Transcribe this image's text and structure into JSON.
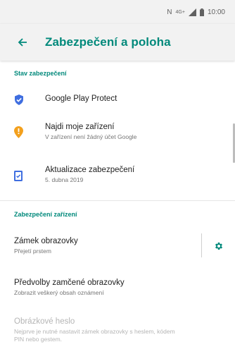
{
  "status_bar": {
    "nfc": "N",
    "network": "4G+",
    "time": "10:00"
  },
  "app_bar": {
    "title": "Zabezpečení a poloha"
  },
  "security_status": {
    "header": "Stav zabezpečení",
    "items": [
      {
        "label": "Google Play Protect",
        "summary": "",
        "icon": "shield-icon",
        "icon_color": "#3f6ee0"
      },
      {
        "label": "Najdi moje zařízení",
        "summary": "V zařízení není žádný účet Google",
        "icon": "location-icon",
        "icon_color": "#f3a01d"
      },
      {
        "label": "Aktualizace zabezpečení",
        "summary": "5. dubna 2019",
        "icon": "update-icon",
        "icon_color": "#3f6ee0"
      }
    ]
  },
  "device_security": {
    "header": "Zabezpečení zařízení",
    "screen_lock": {
      "label": "Zámek obrazovky",
      "summary": "Přejetí prstem"
    },
    "lock_screen_prefs": {
      "label": "Předvolby zamčené obrazovky",
      "summary": "Zobrazit veškerý obsah oznámení"
    },
    "picture_password": {
      "label": "Obrázkové heslo",
      "summary_line1": "Nejprve je nutné nastavit zámek obrazovky s heslem, kódem",
      "summary_line2": "PIN nebo gestem."
    }
  },
  "colors": {
    "accent": "#00897b",
    "app_bar_bg": "#f2f2f2",
    "google_blue": "#3f6ee0",
    "warning": "#f3a01d"
  }
}
